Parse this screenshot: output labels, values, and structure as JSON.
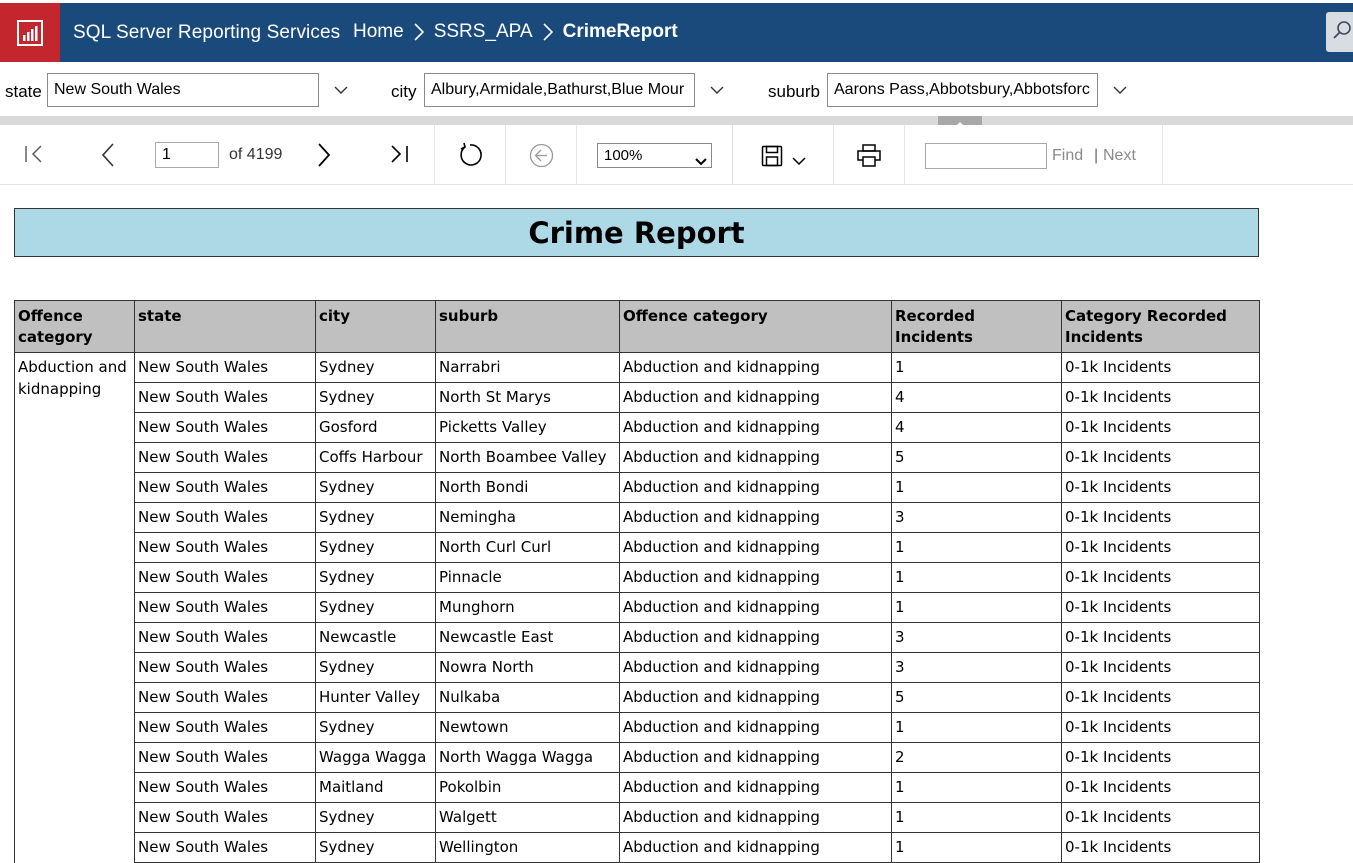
{
  "header": {
    "app_title": "SQL Server Reporting Services",
    "breadcrumb": [
      "Home",
      "SSRS_APA",
      "CrimeReport"
    ],
    "brand_color": "#1a4a7c",
    "logo_color": "#c4262e"
  },
  "params": {
    "state": {
      "label": "state",
      "value": "New South Wales"
    },
    "city": {
      "label": "city",
      "value": "Albury,Armidale,Bathurst,Blue Mour"
    },
    "suburb": {
      "label": "suburb",
      "value": "Aarons Pass,Abbotsbury,Abbotsforc"
    }
  },
  "toolbar": {
    "page_current": "1",
    "page_total_text": "of 4199",
    "zoom": "100%",
    "find_label": "Find",
    "next_separator": "|",
    "next_label": "Next"
  },
  "report": {
    "title": "Crime Report",
    "title_bg": "#add8e6",
    "columns": [
      "Offence category",
      "state",
      "city",
      "suburb",
      "Offence category",
      "Recorded Incidents",
      "Category Recorded Incidents"
    ],
    "group_label": "Abduction and kidnapping",
    "rows": [
      [
        "New South Wales",
        "Sydney",
        "Narrabri",
        "Abduction and kidnapping",
        "1",
        "0-1k Incidents"
      ],
      [
        "New South Wales",
        "Sydney",
        "North St Marys",
        "Abduction and kidnapping",
        "4",
        "0-1k Incidents"
      ],
      [
        "New South Wales",
        "Gosford",
        "Picketts Valley",
        "Abduction and kidnapping",
        "4",
        "0-1k Incidents"
      ],
      [
        "New South Wales",
        "Coffs Harbour",
        "North Boambee Valley",
        "Abduction and kidnapping",
        "5",
        "0-1k Incidents"
      ],
      [
        "New South Wales",
        "Sydney",
        "North Bondi",
        "Abduction and kidnapping",
        "1",
        "0-1k Incidents"
      ],
      [
        "New South Wales",
        "Sydney",
        "Nemingha",
        "Abduction and kidnapping",
        "3",
        "0-1k Incidents"
      ],
      [
        "New South Wales",
        "Sydney",
        "North Curl Curl",
        "Abduction and kidnapping",
        "1",
        "0-1k Incidents"
      ],
      [
        "New South Wales",
        "Sydney",
        "Pinnacle",
        "Abduction and kidnapping",
        "1",
        "0-1k Incidents"
      ],
      [
        "New South Wales",
        "Sydney",
        "Munghorn",
        "Abduction and kidnapping",
        "1",
        "0-1k Incidents"
      ],
      [
        "New South Wales",
        "Newcastle",
        "Newcastle East",
        "Abduction and kidnapping",
        "3",
        "0-1k Incidents"
      ],
      [
        "New South Wales",
        "Sydney",
        "Nowra North",
        "Abduction and kidnapping",
        "3",
        "0-1k Incidents"
      ],
      [
        "New South Wales",
        "Hunter Valley",
        "Nulkaba",
        "Abduction and kidnapping",
        "5",
        "0-1k Incidents"
      ],
      [
        "New South Wales",
        "Sydney",
        "Newtown",
        "Abduction and kidnapping",
        "1",
        "0-1k Incidents"
      ],
      [
        "New South Wales",
        "Wagga Wagga",
        "North Wagga Wagga",
        "Abduction and kidnapping",
        "2",
        "0-1k Incidents"
      ],
      [
        "New South Wales",
        "Maitland",
        "Pokolbin",
        "Abduction and kidnapping",
        "1",
        "0-1k Incidents"
      ],
      [
        "New South Wales",
        "Sydney",
        "Walgett",
        "Abduction and kidnapping",
        "1",
        "0-1k Incidents"
      ],
      [
        "New South Wales",
        "Sydney",
        "Wellington",
        "Abduction and kidnapping",
        "1",
        "0-1k Incidents"
      ]
    ]
  }
}
